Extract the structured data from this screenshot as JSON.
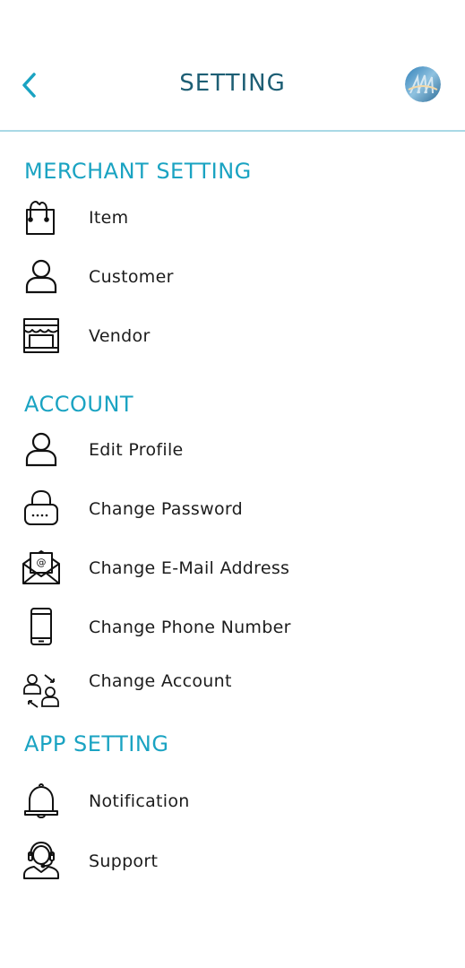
{
  "header": {
    "title": "SETTING",
    "back_icon": "chevron-left-icon",
    "avatar_icon": "avatar"
  },
  "colors": {
    "accent": "#1aa3c2",
    "title": "#1d5e74",
    "divider": "#a9d9e6",
    "text": "#1c1c1c"
  },
  "sections": {
    "merchant": {
      "title": "MERCHANT SETTING",
      "items": [
        {
          "label": "Item",
          "icon": "shopping-bag-icon"
        },
        {
          "label": "Customer",
          "icon": "user-icon"
        },
        {
          "label": "Vendor",
          "icon": "storefront-icon"
        }
      ]
    },
    "account": {
      "title": "ACCOUNT",
      "items": [
        {
          "label": "Edit Profile",
          "icon": "user-icon"
        },
        {
          "label": "Change Password",
          "icon": "lock-icon"
        },
        {
          "label": "Change E-Mail Address",
          "icon": "envelope-icon"
        },
        {
          "label": "Change Phone Number",
          "icon": "phone-icon"
        },
        {
          "label": "Change Account",
          "icon": "switch-account-icon"
        }
      ]
    },
    "app": {
      "title": "APP SETTING",
      "items": [
        {
          "label": "Notification",
          "icon": "bell-icon"
        },
        {
          "label": "Support",
          "icon": "headset-support-icon"
        }
      ]
    }
  }
}
